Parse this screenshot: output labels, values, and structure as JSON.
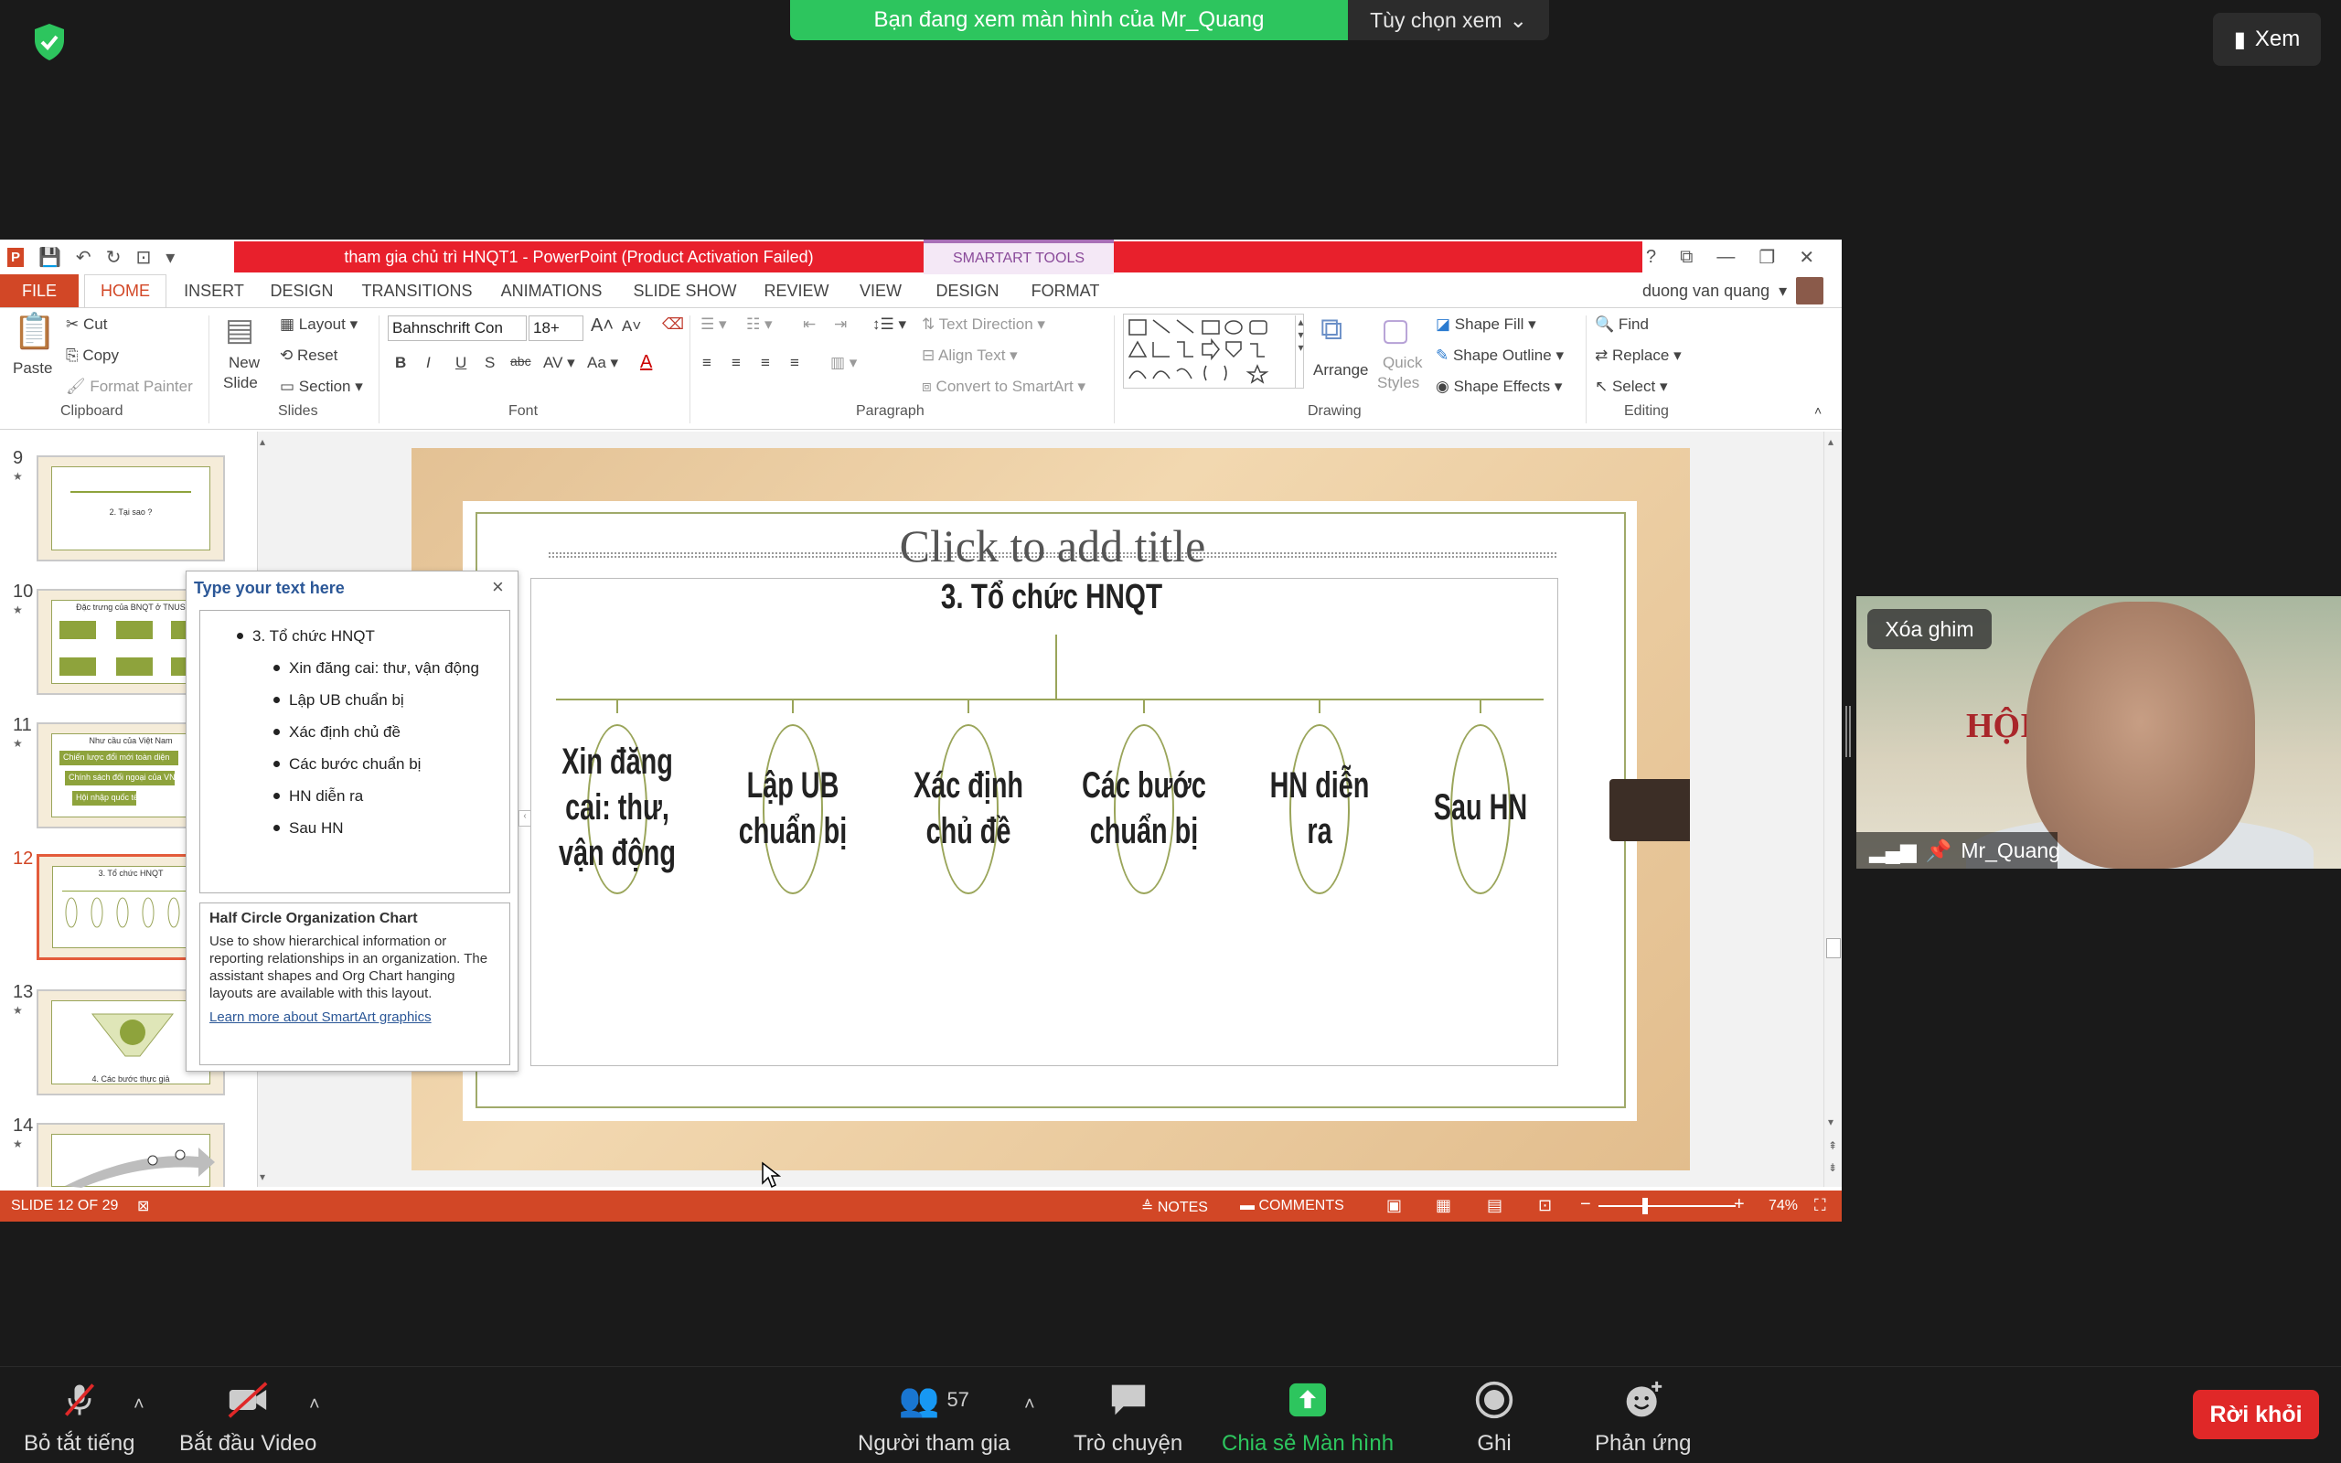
{
  "zoom": {
    "share_banner": "Bạn đang xem màn hình của Mr_Quang",
    "view_options": "Tùy chọn xem",
    "view_button": "Xem",
    "pin_label": "Xóa ghim",
    "participant_name": "Mr_Quang",
    "video_banner_text": "HỘI T          HỌC",
    "toolbar": {
      "mute": "Bỏ tắt tiếng",
      "video": "Bắt đầu Video",
      "participants": "Người tham gia",
      "participants_count": "57",
      "chat": "Trò chuyện",
      "share": "Chia sẻ Màn hình",
      "record": "Ghi",
      "reactions": "Phản ứng",
      "leave": "Rời khỏi"
    },
    "colors": {
      "share_green": "#2dc55e",
      "leave_red": "#e02828"
    }
  },
  "ppt": {
    "window_title": "tham gia chủ trì HNQT1 -  PowerPoint (Product Activation Failed)",
    "contextual_group": "SMARTART TOOLS",
    "user": "duong van quang",
    "tabs": [
      "FILE",
      "HOME",
      "INSERT",
      "DESIGN",
      "TRANSITIONS",
      "ANIMATIONS",
      "SLIDE SHOW",
      "REVIEW",
      "VIEW",
      "DESIGN",
      "FORMAT"
    ],
    "ribbon": {
      "clipboard": {
        "label": "Clipboard",
        "paste": "Paste",
        "cut": "Cut",
        "copy": "Copy",
        "format_painter": "Format Painter"
      },
      "slides": {
        "label": "Slides",
        "new_slide_1": "New",
        "new_slide_2": "Slide",
        "layout": "Layout",
        "reset": "Reset",
        "section": "Section"
      },
      "font": {
        "label": "Font",
        "font_name": "Bahnschrift Con",
        "font_size": "18+"
      },
      "paragraph": {
        "label": "Paragraph",
        "text_direction": "Text Direction",
        "align_text": "Align Text",
        "convert": "Convert to SmartArt"
      },
      "drawing": {
        "label": "Drawing",
        "arrange": "Arrange",
        "quick_styles_1": "Quick",
        "quick_styles_2": "Styles",
        "shape_fill": "Shape Fill",
        "shape_outline": "Shape Outline",
        "shape_effects": "Shape Effects"
      },
      "editing": {
        "label": "Editing",
        "find": "Find",
        "replace": "Replace",
        "select": "Select"
      }
    },
    "slide_numbers": [
      "9",
      "10",
      "11",
      "12",
      "13",
      "14"
    ],
    "thumb_texts": {
      "t9": "2. Tại sao ?",
      "t10_title": "Đặc trưng của BNQT ở TNUS",
      "t11_title": "Như cầu của Việt Nam",
      "t11_a": "Chiến lược đổi mới toàn diện",
      "t11_b": "Chính sách đối ngoại của VN",
      "t11_c": "Hội nhập quốc tế",
      "t12": "3. Tổ chức HNQT",
      "t13": "4. Các bước thực giả"
    },
    "slide": {
      "title_placeholder": "Click to add title",
      "top_node": "3. Tổ chức HNQT",
      "nodes": [
        "Xin đăng cai: thư, vận động",
        "Lập UB chuẩn bị",
        "Xác định chủ đề",
        "Các bước chuẩn bị",
        "HN diễn ra",
        "Sau HN"
      ]
    },
    "text_pane": {
      "title": "Type your text here",
      "items": [
        "3. Tổ chức HNQT",
        "Xin đăng cai: thư, vận động",
        "Lập UB chuẩn bị",
        "Xác định chủ đề",
        "Các bước chuẩn bị",
        "HN diễn ra",
        "Sau HN"
      ],
      "desc_title": "Half Circle Organization Chart",
      "desc_body": "Use to show hierarchical information or reporting relationships in an organization. The assistant shapes and Org Chart hanging layouts are available with this layout.",
      "link": "Learn more about SmartArt graphics"
    },
    "status": {
      "slide_of": "SLIDE 12 OF 29",
      "notes": "NOTES",
      "comments": "COMMENTS",
      "zoom": "74%"
    },
    "colors": {
      "file_tab": "#d24726",
      "title_red": "#e8202c",
      "smartart_green": "#9aa55a"
    }
  }
}
